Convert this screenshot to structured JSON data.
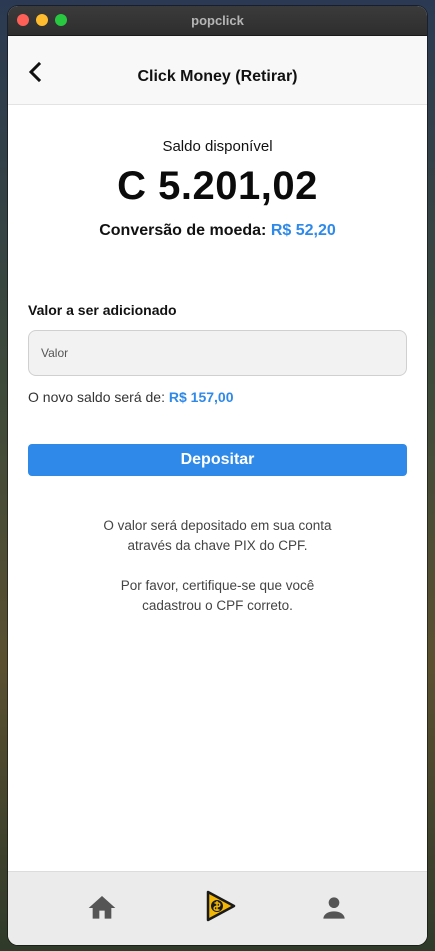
{
  "window": {
    "title": "popclick"
  },
  "header": {
    "title": "Click Money (Retirar)",
    "back_icon": "chevron-left-icon"
  },
  "balance": {
    "label": "Saldo disponível",
    "value": "C 5.201,02",
    "conversion_label": "Conversão de moeda:",
    "conversion_value": "R$ 52,20"
  },
  "form": {
    "field_label": "Valor a ser adicionado",
    "amount_placeholder": "Valor",
    "amount_value": "",
    "new_balance_label": "O novo saldo será de:",
    "new_balance_value": "R$ 157,00",
    "submit_label": "Depositar"
  },
  "info": {
    "line1a": "O valor será depositado em sua conta",
    "line1b": "através da chave PIX do CPF.",
    "line2a": "Por favor, certifique-se que você",
    "line2b": "cadastrou o CPF correto."
  },
  "nav": {
    "items": [
      {
        "icon": "home-icon"
      },
      {
        "icon": "popclick-logo-icon"
      },
      {
        "icon": "profile-icon"
      }
    ]
  },
  "colors": {
    "accent": "#2e89e8",
    "button_text": "#ffffff"
  }
}
